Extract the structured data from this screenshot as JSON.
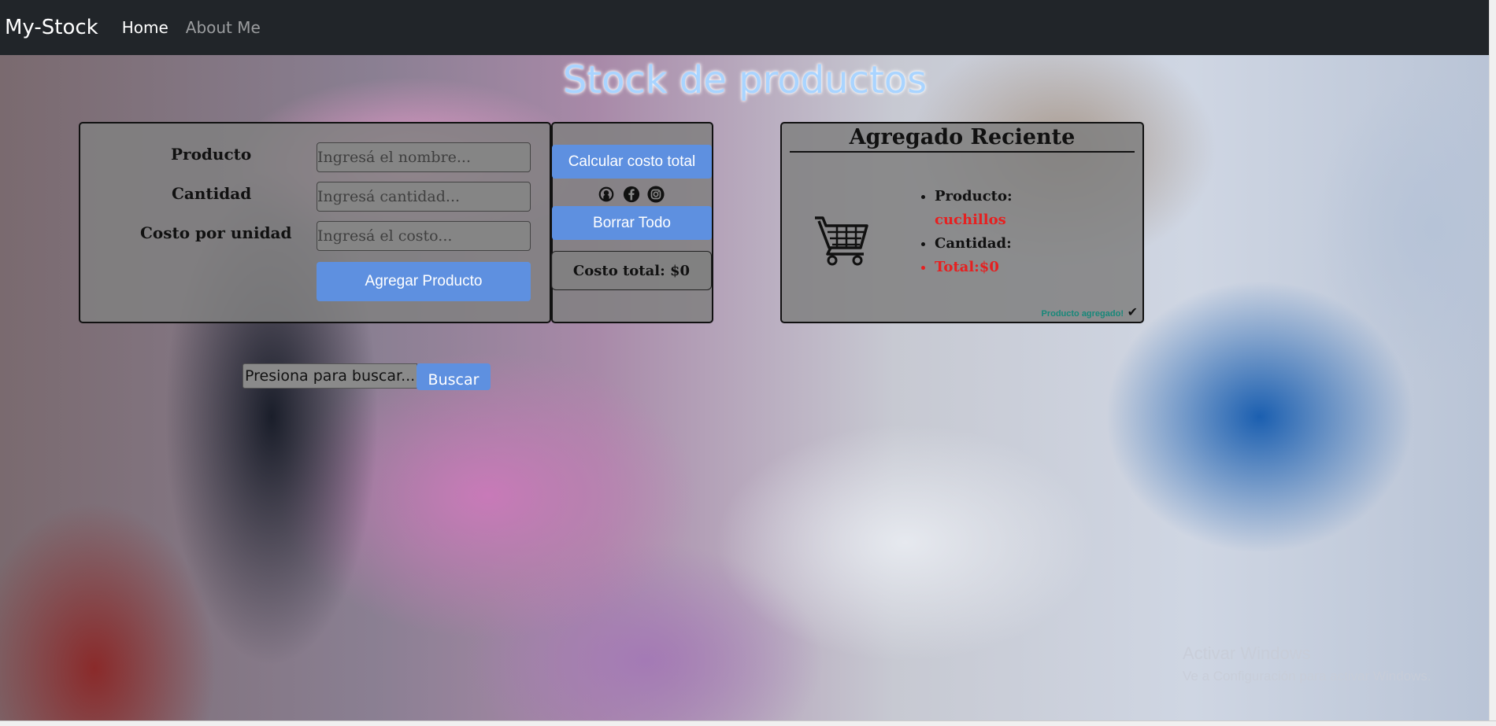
{
  "navbar": {
    "brand": "My-Stock",
    "links": [
      "Home",
      "About Me"
    ]
  },
  "main": {
    "title": "Stock de productos",
    "form": {
      "labels": [
        "Producto",
        "Cantidad",
        "Costo por unidad"
      ],
      "placeholders": [
        "Ingresá el nombre...",
        "Ingresá cantidad...",
        "Ingresá el costo..."
      ],
      "add_button": "Agregar Producto"
    },
    "side": {
      "calc_button": "Calcular costo total",
      "icons": [
        "github-icon",
        "facebook-icon",
        "instagram-icon"
      ],
      "clear_button": "Borrar Todo",
      "total": "Costo total: $0"
    },
    "recent": {
      "title": "Agregado Reciente",
      "cart_icon": "shopping-cart-icon",
      "producto_label": "Producto:",
      "producto_value": "cuchillos",
      "cantidad_label": "Cantidad:",
      "total_text": "Total:$0",
      "status": "Producto agregado!",
      "status_icon": "checkmark-icon"
    },
    "search": {
      "placeholder": "Presiona para buscar...",
      "button": "Buscar"
    }
  },
  "watermark": {
    "line1": "Activar Windows",
    "line2": "Ve a Configuración para activar Windows."
  },
  "colors": {
    "accent": "#5e90e0",
    "navbar": "#212529",
    "highlight": "#e62020",
    "status": "#17887a",
    "title": "#a9d4ff"
  }
}
